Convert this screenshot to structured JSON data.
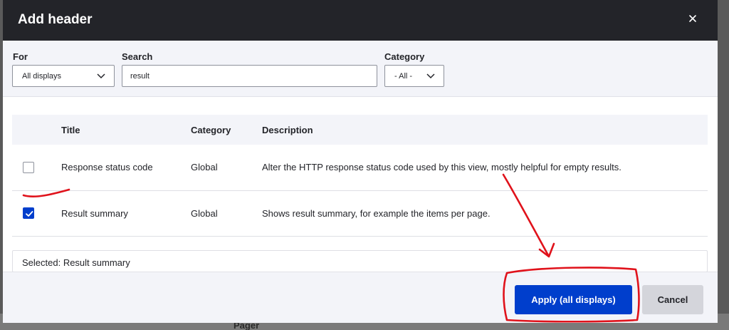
{
  "background": {
    "section_label": "Pager"
  },
  "dialog": {
    "title": "Add header",
    "close_icon": "close-icon"
  },
  "filters": {
    "for": {
      "label": "For",
      "value": "All displays"
    },
    "search": {
      "label": "Search",
      "value": "result"
    },
    "category": {
      "label": "Category",
      "value": "- All -"
    }
  },
  "table": {
    "headers": {
      "title": "Title",
      "category": "Category",
      "description": "Description"
    },
    "rows": [
      {
        "checked": false,
        "title": "Response status code",
        "category": "Global",
        "description": "Alter the HTTP response status code used by this view, mostly helpful for empty results."
      },
      {
        "checked": true,
        "title": "Result summary",
        "category": "Global",
        "description": "Shows result summary, for example the items per page."
      }
    ]
  },
  "selected_text": "Selected: Result summary",
  "buttons": {
    "apply": "Apply (all displays)",
    "cancel": "Cancel"
  },
  "colors": {
    "primary": "#003ecc",
    "titlebar": "#232429",
    "annotation": "#e0121b"
  }
}
